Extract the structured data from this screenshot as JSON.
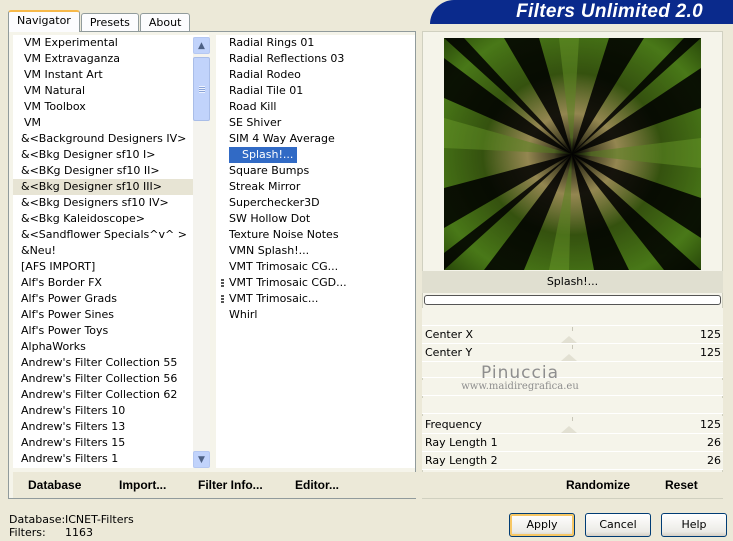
{
  "tabs": [
    "Navigator",
    "Presets",
    "About"
  ],
  "title": "Filters Unlimited 2.0",
  "categories": [
    "VM Experimental",
    "VM Extravaganza",
    "VM Instant Art",
    "VM Natural",
    "VM Toolbox",
    "VM",
    "&<Background Designers IV>",
    "&<Bkg Designer sf10 I>",
    "&<BKg Designer sf10 II>",
    "&<Bkg Designer sf10 III>",
    "&<Bkg Designers sf10 IV>",
    "&<Bkg Kaleidoscope>",
    "&<Sandflower Specials^v^ >",
    "&Neu!",
    "[AFS IMPORT]",
    "Alf's Border FX",
    "Alf's Power Grads",
    "Alf's Power Sines",
    "Alf's Power Toys",
    "AlphaWorks",
    "Andrew's Filter Collection 55",
    "Andrew's Filter Collection 56",
    "Andrew's Filter Collection 62",
    "Andrew's Filters 10",
    "Andrew's Filters 13",
    "Andrew's Filters 15",
    "Andrew's Filters 1"
  ],
  "filters": [
    "Radial  Rings 01",
    "Radial Reflections 03",
    "Radial Rodeo",
    "Radial Tile 01",
    "Road Kill",
    "SE Shiver",
    "SIM 4 Way Average",
    "Splash!...",
    "Square Bumps",
    "Streak Mirror",
    "Superchecker3D",
    "SW Hollow Dot",
    "Texture Noise Notes",
    "VMN Splash!...",
    "VMT Trimosaic CG...",
    "VMT Trimosaic CGD...",
    "VMT Trimosaic...",
    "Whirl"
  ],
  "left_buttons": {
    "database": "Database",
    "import": "Import...",
    "filter_info": "Filter Info...",
    "editor": "Editor..."
  },
  "preview_caption": "Splash!...",
  "params": [
    {
      "label": "Center X",
      "value": "125"
    },
    {
      "label": "Center Y",
      "value": "125"
    },
    {
      "label": "Frequency",
      "value": "125"
    },
    {
      "label": "Ray Length 1",
      "value": "26"
    },
    {
      "label": "Ray Length 2",
      "value": "26"
    }
  ],
  "watermark": {
    "name": "Pinuccia",
    "url": "www.maidiregrafica.eu"
  },
  "right_buttons": {
    "randomize": "Randomize",
    "reset": "Reset"
  },
  "status": {
    "db_label": "Database:",
    "db_value": "ICNET-Filters",
    "filters_label": "Filters:",
    "filters_value": "1163"
  },
  "dialog_buttons": {
    "apply": "Apply",
    "cancel": "Cancel",
    "help": "Help"
  },
  "colors": {
    "banner": "#0a2a8c",
    "selection": "#316ac5",
    "tab_accent": "#f7b94a"
  }
}
